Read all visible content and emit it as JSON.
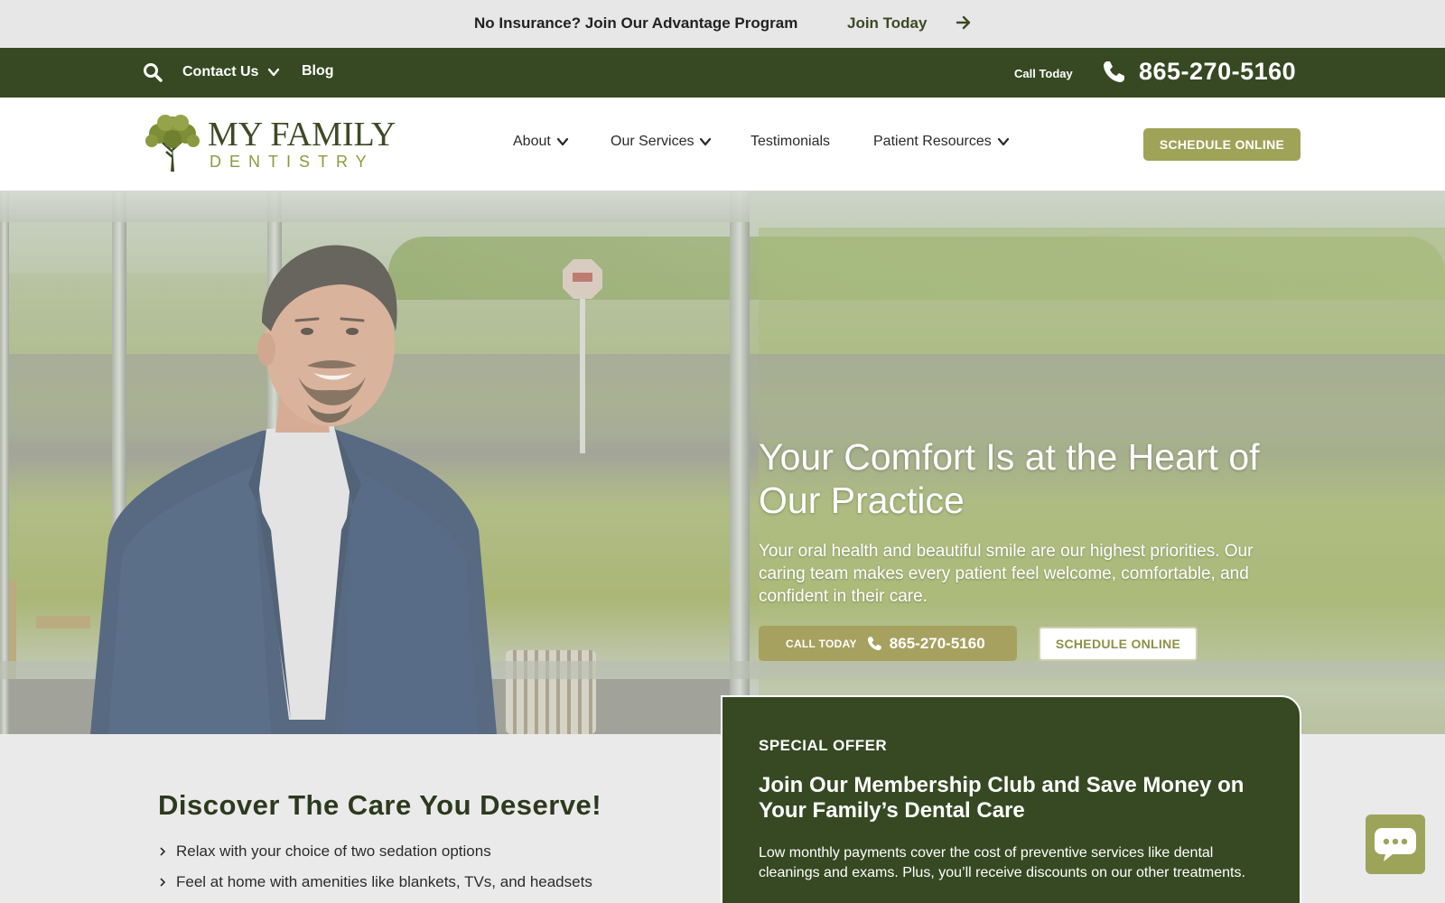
{
  "announcement": {
    "text": "No Insurance? Join Our Advantage Program",
    "link": "Join Today",
    "arrow_icon": "arrow-right-icon"
  },
  "utility_bar": {
    "search_icon": "search-icon",
    "contact": "Contact Us",
    "blog": "Blog",
    "call_label": "Call Today",
    "phone": "865-270-5160"
  },
  "header": {
    "logo_line1": "MY FAMILY",
    "logo_line2": "DENTISTRY",
    "nav": {
      "about": "About",
      "services": "Our Services",
      "testimonials": "Testimonials",
      "resources": "Patient Resources"
    },
    "schedule": "SCHEDULE ONLINE"
  },
  "hero": {
    "title": "Your Comfort Is at the Heart of Our Practice",
    "subtitle": "Your oral health and beautiful smile are our highest priorities. Our caring team makes every patient feel welcome, comfortable, and confident in their care.",
    "call_label": "CALL TODAY",
    "call_number": "865-270-5160",
    "schedule": "SCHEDULE ONLINE"
  },
  "discover": {
    "title": "Discover The Care You Deserve!",
    "items": [
      "Relax with your choice of two sedation options",
      "Feel at home with amenities like blankets, TVs, and headsets"
    ]
  },
  "offer": {
    "label": "SPECIAL OFFER",
    "title": "Join Our Membership Club and Save Money on Your Family’s Dental Care",
    "body": "Low monthly payments cover the cost of preventive services like dental cleanings and exams. Plus, you’ll receive discounts on our other treatments."
  },
  "colors": {
    "brand_green": "#364922",
    "accent_olive": "#9fa358",
    "background": "#ebeaeb"
  }
}
